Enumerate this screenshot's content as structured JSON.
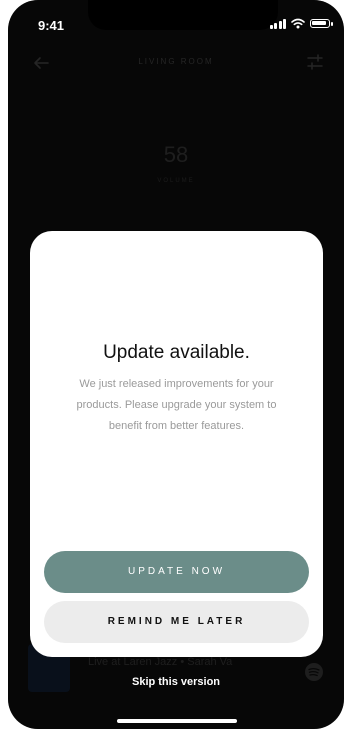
{
  "status_bar": {
    "time": "9:41",
    "icons": [
      "cellular-signal-icon",
      "wifi-icon",
      "battery-icon"
    ]
  },
  "header": {
    "title": "LIVING ROOM",
    "back_icon": "arrow-left-icon",
    "settings_icon": "sliders-icon"
  },
  "volume": {
    "value": "58",
    "label": "VOLUME"
  },
  "now_playing": {
    "text": "Live at Laren Jazz • Sarah Va",
    "service_icon": "spotify-icon"
  },
  "modal": {
    "title": "Update available.",
    "body": "We just released improvements for your products. Please upgrade your system to benefit from better features.",
    "primary_label": "UPDATE NOW",
    "secondary_label": "REMIND ME LATER"
  },
  "skip_label": "Skip this version",
  "colors": {
    "accent": "#6b8d89",
    "secondary_button": "#ececec",
    "background": "#0c0c0c"
  }
}
